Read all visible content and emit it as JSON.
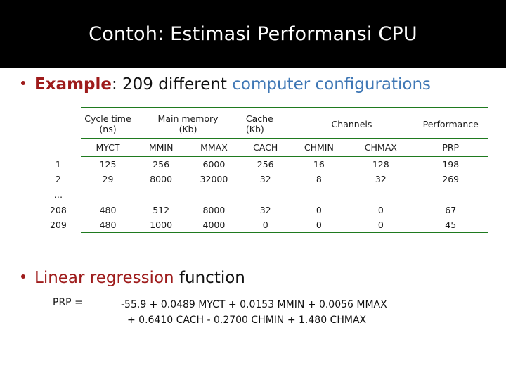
{
  "slide": {
    "title": "Contoh: Estimasi Performansi CPU"
  },
  "bullets": {
    "example": {
      "lead": "Example",
      "middle": ": 209 different ",
      "highlight": "computer configurations"
    },
    "regression": {
      "lead": "Linear regression",
      "rest": " function"
    }
  },
  "table": {
    "group_headers": [
      {
        "line1": "Cycle time",
        "line2": "(ns)"
      },
      {
        "line1": "Main memory",
        "line2": "(Kb)"
      },
      {
        "line1": "Cache",
        "line2": "(Kb)"
      },
      {
        "line1": "Channels",
        "line2": ""
      },
      {
        "line1": "Performance",
        "line2": ""
      }
    ],
    "columns": [
      "MYCT",
      "MMIN",
      "MMAX",
      "CACH",
      "CHMIN",
      "CHMAX",
      "PRP"
    ],
    "rows": [
      {
        "index": "1",
        "values": [
          "125",
          "256",
          "6000",
          "256",
          "16",
          "128",
          "198"
        ]
      },
      {
        "index": "2",
        "values": [
          "29",
          "8000",
          "32000",
          "32",
          "8",
          "32",
          "269"
        ]
      },
      {
        "index": "…",
        "values": [
          "",
          "",
          "",
          "",
          "",
          "",
          ""
        ]
      },
      {
        "index": "208",
        "values": [
          "480",
          "512",
          "8000",
          "32",
          "0",
          "0",
          "67"
        ]
      },
      {
        "index": "209",
        "values": [
          "480",
          "1000",
          "4000",
          "0",
          "0",
          "0",
          "45"
        ]
      }
    ]
  },
  "formula": {
    "label": "PRP =",
    "line1": "-55.9 + 0.0489 MYCT + 0.0153 MMIN + 0.0056 MMAX",
    "line2": "+ 0.6410 CACH - 0.2700 CHMIN + 1.480 CHMAX"
  },
  "colors": {
    "banner_background": "#000000",
    "title_text": "#ffffff",
    "accent_red": "#9e1b1b",
    "accent_blue": "#3f77b5",
    "table_fill": "#ccf5cc",
    "table_rule": "#1f7a1f"
  }
}
